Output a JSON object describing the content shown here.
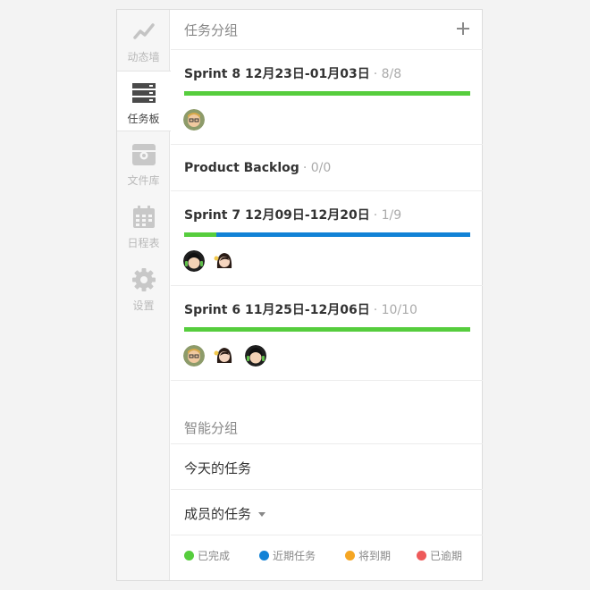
{
  "sidebar": {
    "items": [
      {
        "label": "动态墙",
        "icon": "activity-chart-icon",
        "active": false
      },
      {
        "label": "任务板",
        "icon": "task-board-icon",
        "active": true
      },
      {
        "label": "文件库",
        "icon": "file-library-icon",
        "active": false
      },
      {
        "label": "日程表",
        "icon": "calendar-icon",
        "active": false
      },
      {
        "label": "设置",
        "icon": "gear-icon",
        "active": false
      }
    ]
  },
  "main": {
    "task_groups_title": "任务分组",
    "sprints": [
      {
        "name": "Sprint 8 12月23日-01月03日",
        "count": "· 8/8",
        "progress": 1.0,
        "avatars": [
          "blonde-glasses-avatar"
        ]
      },
      {
        "name": "Product Backlog",
        "count": "· 0/0",
        "progress": null,
        "avatars": []
      },
      {
        "name": "Sprint 7 12月09日-12月20日",
        "count": "· 1/9",
        "progress": 0.111,
        "avatars": [
          "dark-hair-headphones-avatar",
          "dark-hair-woman-avatar"
        ]
      },
      {
        "name": "Sprint 6 11月25日-12月06日",
        "count": "· 10/10",
        "progress": 1.0,
        "avatars": [
          "blonde-glasses-avatar",
          "dark-hair-woman-avatar",
          "dark-hair-headphones-avatar"
        ]
      }
    ],
    "smart_groups_title": "智能分组",
    "today_tasks": "今天的任务",
    "member_tasks": "成员的任务",
    "legend": [
      {
        "label": "已完成",
        "color": "#56cd3d"
      },
      {
        "label": "近期任务",
        "color": "#1182d6"
      },
      {
        "label": "将到期",
        "color": "#f5a623"
      },
      {
        "label": "已逾期",
        "color": "#ee5a5a"
      }
    ]
  },
  "colors": {
    "done": "#56cd3d",
    "in_progress": "#1182d6",
    "sidebar_bg": "#f6f6f6"
  }
}
